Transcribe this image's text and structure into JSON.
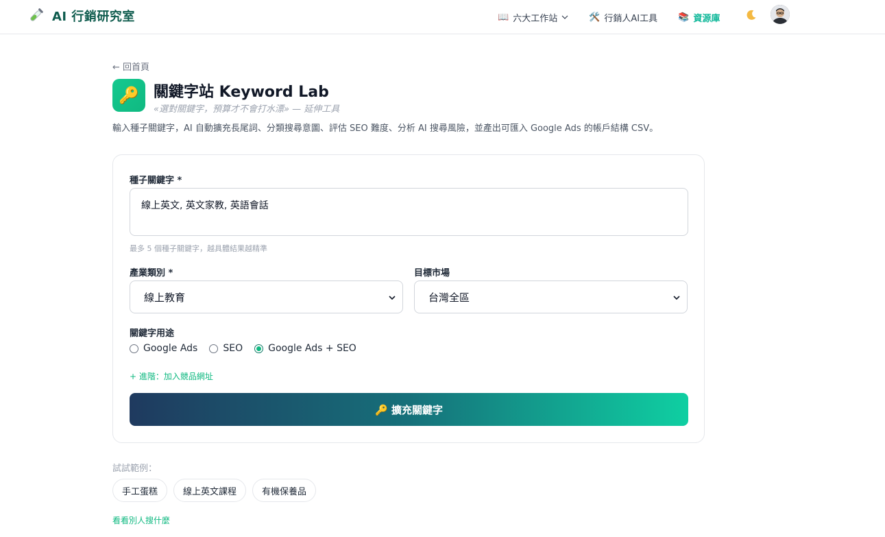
{
  "navbar": {
    "brand": "AI 行銷研究室",
    "items": [
      {
        "icon": "📖",
        "label": "六大工作站",
        "has_dropdown": true,
        "active": false
      },
      {
        "icon": "🛠️",
        "label": "行銷人AI工具",
        "has_dropdown": false,
        "active": false
      },
      {
        "icon": "📚",
        "label": "資源庫",
        "has_dropdown": false,
        "active": true
      }
    ],
    "theme_toggle_icon": "moon-icon",
    "accent_color": "#10b89a"
  },
  "header": {
    "back_label": "← 回首頁",
    "app_icon": "🔑",
    "title": "關鍵字站 Keyword Lab",
    "subtitle": "«選對關鍵字，預算才不會打水漂» — 延伸工具",
    "description": "輸入種子關鍵字，AI 自動擴充長尾詞、分類搜尋意圖、評估 SEO 難度、分析 AI 搜尋風險，並產出可匯入 Google Ads 的帳戶結構 CSV。"
  },
  "form": {
    "seed_label": "種子關鍵字 *",
    "seed_value": "線上英文, 英文家教, 英語會話",
    "seed_hint": "最多 5 個種子關鍵字，越具體結果越精準",
    "industry_label": "產業類別 *",
    "industry_value": "線上教育",
    "market_label": "目標市場",
    "market_value": "台灣全區",
    "purpose_label": "關鍵字用途",
    "purpose_options": [
      {
        "label": "Google Ads",
        "checked": false
      },
      {
        "label": "SEO",
        "checked": false
      },
      {
        "label": "Google Ads + SEO",
        "checked": true
      }
    ],
    "advanced_label": "+ 進階：加入競品網址",
    "submit_label": "🔑 擴充關鍵字"
  },
  "examples": {
    "label": "試試範例：",
    "chips": [
      "手工蛋糕",
      "線上英文課程",
      "有機保養品"
    ],
    "see_others_label": "看看別人搜什麼"
  }
}
